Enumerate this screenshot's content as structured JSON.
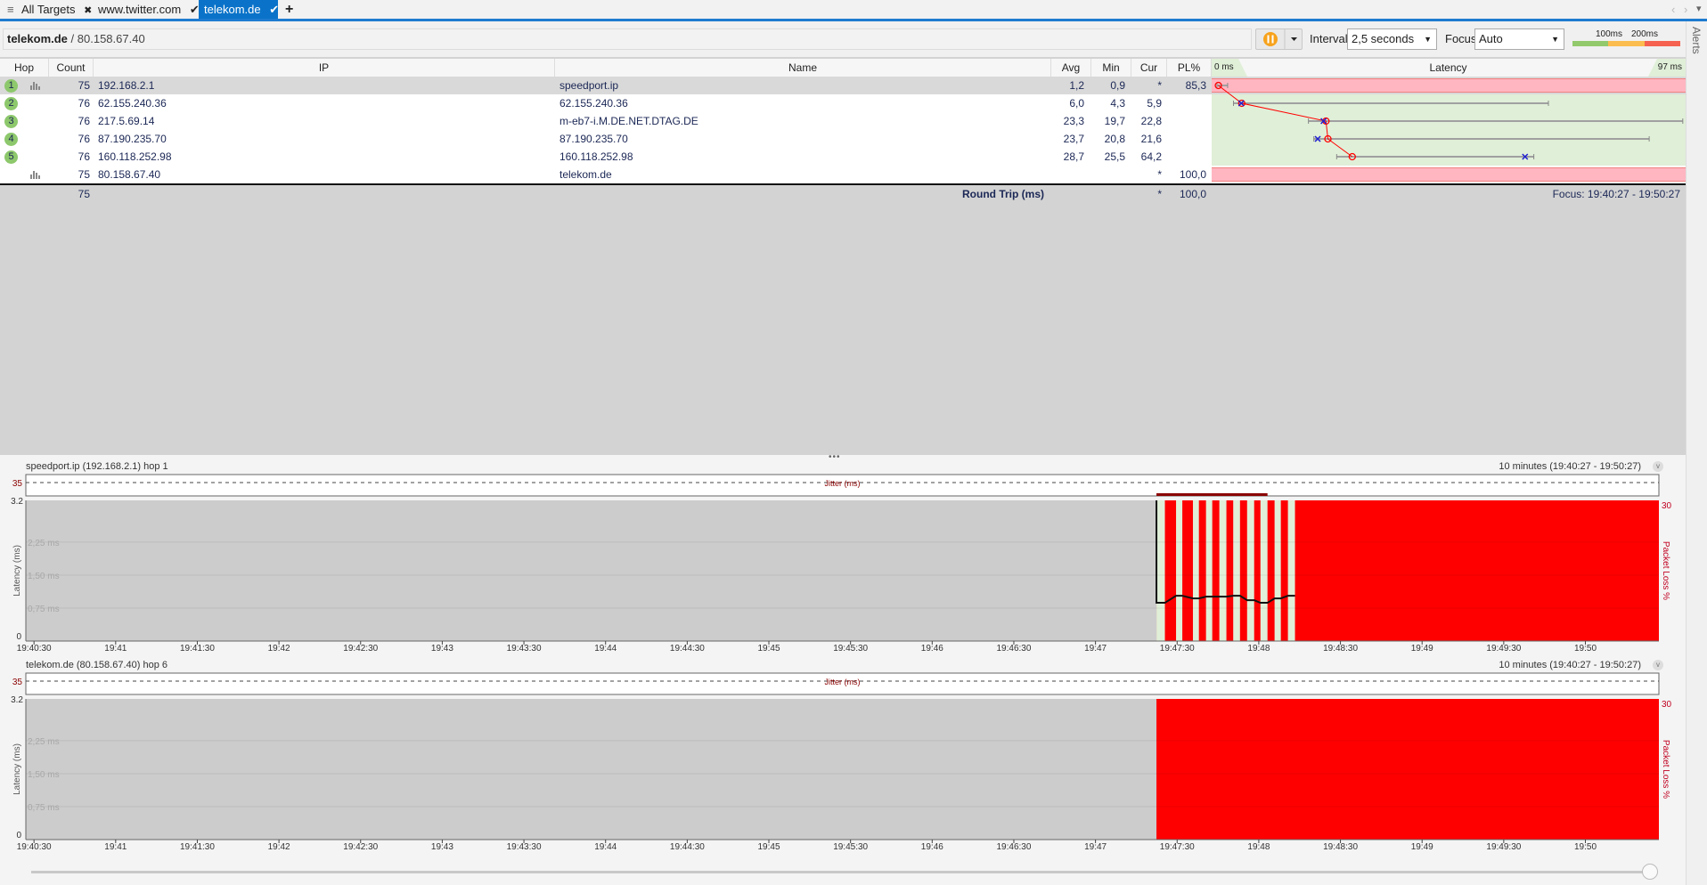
{
  "tabs": [
    {
      "label": "All Targets",
      "icon": "close-icon",
      "glyph": "✖"
    },
    {
      "label": "www.twitter.com",
      "icon": "check-icon",
      "glyph": "✔"
    },
    {
      "label": "telekom.de",
      "icon": "check-icon",
      "glyph": "✔",
      "active": true
    }
  ],
  "tab_add": "+",
  "menu_glyph": "≡",
  "nav_glyphs": {
    "prev": "‹",
    "next": "›",
    "dropdown": "▾"
  },
  "toolbar": {
    "target_name": "telekom.de",
    "target_sep": " / ",
    "target_ip": "80.158.67.40",
    "interval_label": "Interval",
    "interval_value": "2,5 seconds",
    "focus_label": "Focus",
    "focus_value": "Auto",
    "legend_100": "100ms",
    "legend_200": "200ms",
    "colors": {
      "good": "#92c96c",
      "warn": "#fbbd4f",
      "bad": "#f5624f",
      "pause": "#f7a21b"
    }
  },
  "alerts_label": "Alerts",
  "table": {
    "columns": [
      "Hop",
      "Count",
      "IP",
      "Name",
      "Avg",
      "Min",
      "Cur",
      "PL%",
      "Latency"
    ],
    "latency_scale": {
      "min_label": "0 ms",
      "max_label": "97 ms",
      "max": 97
    },
    "rows": [
      {
        "hop": "1",
        "count": "75",
        "ip": "192.168.2.1",
        "name": "speedport.ip",
        "avg": "1,2",
        "min": "0,9",
        "cur": "*",
        "pl": "85,3",
        "avg_v": 1.2,
        "min_v": 0.9,
        "max_v": 3.1,
        "cur_v": null,
        "loss": true,
        "chart": true,
        "selected": true
      },
      {
        "hop": "2",
        "count": "76",
        "ip": "62.155.240.36",
        "name": "62.155.240.36",
        "avg": "6,0",
        "min": "4,3",
        "cur": "5,9",
        "pl": "",
        "avg_v": 6.0,
        "min_v": 4.3,
        "max_v": 69,
        "cur_v": 5.9,
        "loss": false
      },
      {
        "hop": "3",
        "count": "76",
        "ip": "217.5.69.14",
        "name": "m-eb7-i.M.DE.NET.DTAG.DE",
        "avg": "23,3",
        "min": "19,7",
        "cur": "22,8",
        "pl": "",
        "avg_v": 23.3,
        "min_v": 19.7,
        "max_v": 96.6,
        "cur_v": 22.8,
        "loss": false
      },
      {
        "hop": "4",
        "count": "76",
        "ip": "87.190.235.70",
        "name": "87.190.235.70",
        "avg": "23,7",
        "min": "20,8",
        "cur": "21,6",
        "pl": "",
        "avg_v": 23.7,
        "min_v": 20.8,
        "max_v": 89.7,
        "cur_v": 21.6,
        "loss": false
      },
      {
        "hop": "5",
        "count": "76",
        "ip": "160.118.252.98",
        "name": "160.118.252.98",
        "avg": "28,7",
        "min": "25,5",
        "cur": "64,2",
        "pl": "",
        "avg_v": 28.7,
        "min_v": 25.5,
        "max_v": 66,
        "cur_v": 64.2,
        "loss": false
      },
      {
        "hop": "",
        "count": "75",
        "ip": "80.158.67.40",
        "name": "telekom.de",
        "avg": "",
        "min": "",
        "cur": "*",
        "pl": "100,0",
        "avg_v": null,
        "loss": true,
        "chart": true
      }
    ],
    "summary": {
      "count": "75",
      "label": "Round Trip (ms)",
      "cur": "*",
      "pl": "100,0",
      "focus": "Focus: 19:40:27 - 19:50:27"
    },
    "colors": {
      "loss_bg": "#ffb6c1",
      "ok_bg": "#e0efd8",
      "avg_marker": "#ff0000",
      "cur_marker": "#1f1fd0",
      "whisker": "#a0a0a0"
    }
  },
  "splitter_glyph": "•••",
  "chart_data": [
    {
      "type": "area",
      "title": "speedport.ip (192.168.2.1) hop 1",
      "range_label": "10 minutes (19:40:27 - 19:50:27)",
      "x_start": "19:40:27",
      "x_end": "19:50:27",
      "x_ticks": [
        "19:40:30",
        "19:41",
        "19:41:30",
        "19:42",
        "19:42:30",
        "19:43",
        "19:43:30",
        "19:44",
        "19:44:30",
        "19:45",
        "19:45:30",
        "19:46",
        "19:46:30",
        "19:47",
        "19:47:30",
        "19:48",
        "19:48:30",
        "19:49",
        "19:49:30",
        "19:50"
      ],
      "ylabel": "Latency (ms)",
      "ylim": [
        0,
        3.2
      ],
      "y_top_label": "3.2",
      "y_bottom_label": "0",
      "gridlines": [
        {
          "value": 2.25,
          "label": "2,25 ms"
        },
        {
          "value": 1.5,
          "label": "1,50 ms"
        },
        {
          "value": 0.75,
          "label": "0,75 ms"
        }
      ],
      "y2label": "Packet Loss %",
      "y2_top_label": "30",
      "jitter_label": "Jitter (ms)",
      "jitter_max_label": "35",
      "jitter_bars": [
        {
          "start": "19:47:22.4",
          "end": "19:48:03.2"
        }
      ],
      "loss_start": "19:47:22.4",
      "loss_end": "19:50:27",
      "ok_samples": [
        {
          "start": "19:47:22.4",
          "end": "19:47:25.5",
          "latency": 0.87
        },
        {
          "start": "19:47:29.6",
          "end": "19:47:31.9",
          "latency": 1.03
        },
        {
          "start": "19:47:35.8",
          "end": "19:47:38.0",
          "latency": 0.97
        },
        {
          "start": "19:47:40.6",
          "end": "19:47:42.9",
          "latency": 1.01
        },
        {
          "start": "19:47:45.5",
          "end": "19:47:48.1",
          "latency": 1.01
        },
        {
          "start": "19:47:50.6",
          "end": "19:47:53.1",
          "latency": 1.03
        },
        {
          "start": "19:47:55.7",
          "end": "19:47:58.3",
          "latency": 0.93
        },
        {
          "start": "19:48:00.6",
          "end": "19:48:03.2",
          "latency": 0.87
        },
        {
          "start": "19:48:05.8",
          "end": "19:48:08.1",
          "latency": 0.97
        },
        {
          "start": "19:48:10.7",
          "end": "19:48:13.3",
          "latency": 1.03
        }
      ],
      "colors": {
        "no_data": "#cccccc",
        "ok": "#e0efd8",
        "loss": "#ff0000",
        "latency": "#111111",
        "jitter": "#8b0000"
      }
    },
    {
      "type": "area",
      "title": "telekom.de (80.158.67.40) hop 6",
      "range_label": "10 minutes (19:40:27 - 19:50:27)",
      "x_start": "19:40:27",
      "x_end": "19:50:27",
      "x_ticks": [
        "19:40:30",
        "19:41",
        "19:41:30",
        "19:42",
        "19:42:30",
        "19:43",
        "19:43:30",
        "19:44",
        "19:44:30",
        "19:45",
        "19:45:30",
        "19:46",
        "19:46:30",
        "19:47",
        "19:47:30",
        "19:48",
        "19:48:30",
        "19:49",
        "19:49:30",
        "19:50"
      ],
      "ylabel": "Latency (ms)",
      "ylim": [
        0,
        3.2
      ],
      "y_top_label": "3.2",
      "y_bottom_label": "0",
      "gridlines": [
        {
          "value": 2.25,
          "label": "2,25 ms"
        },
        {
          "value": 1.5,
          "label": "1,50 ms"
        },
        {
          "value": 0.75,
          "label": "0,75 ms"
        }
      ],
      "y2label": "Packet Loss %",
      "y2_top_label": "30",
      "jitter_label": "Jitter (ms)",
      "jitter_max_label": "35",
      "jitter_bars": [],
      "loss_start": "19:47:22.4",
      "loss_end": "19:50:27",
      "ok_samples": [],
      "colors": {
        "no_data": "#cccccc",
        "ok": "#e0efd8",
        "loss": "#ff0000",
        "latency": "#111111",
        "jitter": "#8b0000"
      }
    }
  ],
  "timeline_slider": {
    "position_pct": 100
  }
}
